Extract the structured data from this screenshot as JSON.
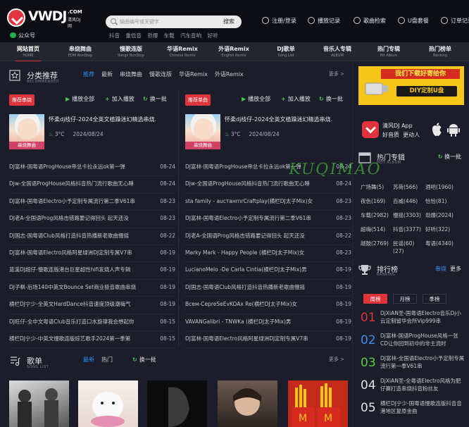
{
  "header": {
    "logo_text": "VWDJ",
    "logo_com": ".COM",
    "logo_sub": "清风DJ网",
    "wechat_label": "公众号",
    "search_placeholder": "输曲编号或关键字",
    "search_button": "搜索",
    "hot_words": [
      "抖音",
      "重低音",
      "劲爆",
      "车载",
      "汽车音响",
      "好听"
    ],
    "top_links": [
      "注册/登录",
      "播放记录",
      "歌曲检索",
      "U盘套餐",
      "订单记录"
    ]
  },
  "nav": [
    {
      "cn": "网站首页",
      "en": "HOME"
    },
    {
      "cn": "串烧舞曲",
      "en": "EDM NonStop"
    },
    {
      "cn": "慢歌连版",
      "en": "Songs NonStop"
    },
    {
      "cn": "华语Remix",
      "en": "Chinese Remix"
    },
    {
      "cn": "外语Remix",
      "en": "English Remix"
    },
    {
      "cn": "DJ歌单",
      "en": "Song List"
    },
    {
      "cn": "音乐人专辑",
      "en": "ALBUM"
    },
    {
      "cn": "热门专辑",
      "en": "Hit Album"
    },
    {
      "cn": "热门榜单",
      "en": "Ranking"
    }
  ],
  "recommend": {
    "title": "分类推荐",
    "subtitle": "RECOMMENDED",
    "tabs": [
      "推荐",
      "最新",
      "串烧舞曲",
      "慢歌连版",
      "华语Remix",
      "外语Remix"
    ],
    "more": "更多 >"
  },
  "left_col": {
    "badge": "推荐串烧",
    "play_all": "播放全部",
    "add_play": "加入播放",
    "refresh": "换一批",
    "cover_label": "串烧舞曲",
    "feat_title": "怀柔dj枝仔-2024全英文植躁迷幻精选串烧.",
    "feat_temp": "3°C",
    "feat_date": "2024/08/24",
    "songs": [
      {
        "t": "DJ富林-国粤语ProgHouse帝总卡拉永远ok第一弹",
        "d": "08-24"
      },
      {
        "t": "Djw-全国语ProgHouse风格抖音热门流行歌曲无心睡",
        "d": "08-24"
      },
      {
        "t": "DJ富林-国粤语Electro小予定制专属流行第二季V61串",
        "d": "08-23"
      },
      {
        "t": "DJ老A-全国语Prog风格击错路要记得回头 起天还没",
        "d": "08-23"
      },
      {
        "t": "DJ国志-国粤语Club风格打造抖音热播新老歌曲慢摇",
        "d": "08-22"
      },
      {
        "t": "DJ富林-国粤语Electro风格阿星绿洲DJ定制专属V7串",
        "d": "08-19"
      },
      {
        "t": "蓝溪DJ超仔-慢歌连版港台巨星超性hifi发烧人声专辑",
        "d": "08-19"
      },
      {
        "t": "DJ子枫-后场140中英文Bounce Set商业极音歌曲串烧",
        "d": "08-19"
      },
      {
        "t": "横栏DJ宁少-全英文HardDance抖音速度顶级潮嗨气",
        "d": "08-19"
      },
      {
        "t": "DJ旺仔-全中文粤语Club音乐打造口水旋律我会想起你",
        "d": "08-15"
      },
      {
        "t": "横栏DJ宁少-中英文慢歌连版综艺歌手2024第一季第",
        "d": "08-15"
      }
    ]
  },
  "right_col": {
    "badge": "推荐单曲",
    "play_all": "播放全部",
    "add_play": "加入播放",
    "refresh": "换一批",
    "cover_label": "串烧舞曲",
    "feat_title": "怀柔dj枝仔-2024全英文植躁迷幻精选串烧.",
    "feat_temp": "3°C",
    "feat_date": "2024/08/24",
    "songs": [
      {
        "t": "DJ富林-国粤语ProgHouse帝总卡拉永远ok第一弹",
        "d": "08-24"
      },
      {
        "t": "Djw-全国语ProgHouse风格抖音热门流行歌曲无心睡",
        "d": "08-24"
      },
      {
        "t": "sta family - aucтaнrnrCraftplay(横栏DJ太子Mix)女",
        "d": "08-23"
      },
      {
        "t": "DJ富林-国粤语Electro小予定制专属流行第二季V61串",
        "d": "08-23"
      },
      {
        "t": "DJ老A-全国语Prog风格击错路要记得回头 起天还没",
        "d": "08-22"
      },
      {
        "t": "Marky Mark - Happy People (横栏DJ太子Mix)女",
        "d": "08-23"
      },
      {
        "t": "LucianoMelo -De Carla Cintia(横栏DJ太子Mix)男",
        "d": "08-19"
      },
      {
        "t": "DJ国志-国粤语Club风格打造抖音热播新老歌曲慢摇",
        "d": "08-19"
      },
      {
        "t": "Всем-CepreSeEvKOAx Re(横栏DJ太子Mix)女",
        "d": "08-19"
      },
      {
        "t": "VAVANGalibri - TNWKa (横栏DJ太子Mix)男",
        "d": "08-19"
      },
      {
        "t": "DJ富林-国粤语Electro风格阿星绿洲DJ定制专属V7串",
        "d": "08-19"
      }
    ]
  },
  "songlist": {
    "title": "歌单",
    "subtitle": "SONG LIST",
    "tabs": [
      "最新",
      "热门"
    ],
    "refresh": "换一批",
    "more": "更多 >"
  },
  "side": {
    "ad_top": "我们下载好寄给你",
    "ad_bottom": "DIY定制U盘",
    "app_line1": "清风DJ App",
    "app_line2a": "好音质",
    "app_line2b": "更动人",
    "hot_album_title": "热门专辑",
    "hot_album_sub": "HOT ALBUM",
    "hot_album_refresh": "换一批",
    "genres": [
      "广场舞(5)",
      "苏荷(566)",
      "酒吧(1960)",
      "夜色(169)",
      "百威(446)",
      "恰恰(81)",
      "车载(2982)",
      "慢摇(3303)",
      "劲爆(2024)",
      "超嗨(514)",
      "抖音(3377)",
      "好听(322)",
      "越鼓(2769)",
      "民谣(60)",
      "粤语(4340)"
    ],
    "genre_extra": "(27)",
    "rank_title": "排行榜",
    "rank_sub": "RANKING",
    "rank_type": "串烧",
    "rank_more": "更多",
    "rank_tabs": [
      "周榜",
      "月榜",
      "季榜"
    ],
    "ranks": [
      {
        "n": "01",
        "t": "DjXiAN圣-国粤语Electro音乐Dj小云定制留华会所Vip999串"
      },
      {
        "n": "02",
        "t": "Dj富林-国语ProgHouse风格一张CD让你回到初中的非主流时"
      },
      {
        "n": "03",
        "t": "DJ富林-全国语Electro小予定制专属流行第一季V61串"
      },
      {
        "n": "04",
        "t": "DjXiAN圣-全粤语Electro风格为肥仔赛打造串烧抖音粉丝友"
      },
      {
        "n": "05",
        "t": "横栏DJ宁少-国粤语慢歌连版抖音音港地区复原金曲"
      }
    ],
    "rank_colors": [
      "#e0343d",
      "#3c8ff0",
      "#5ecb3c",
      "#dfe2ea",
      "#dfe2ea"
    ]
  },
  "watermark": "KUQIMAO"
}
